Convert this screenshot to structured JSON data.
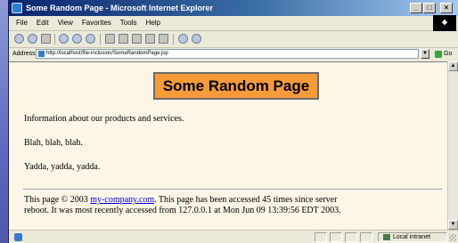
{
  "window": {
    "title": "Some Random Page - Microsoft Internet Explorer",
    "minimize": "_",
    "maximize": "□",
    "close": "×"
  },
  "menu": {
    "items": [
      "File",
      "Edit",
      "View",
      "Favorites",
      "Tools",
      "Help"
    ]
  },
  "address": {
    "label": "Address",
    "url": "http://localhost/file-inclusion/SomeRandomPage.jsp",
    "go_label": "Go"
  },
  "page": {
    "heading": "Some Random Page",
    "paragraphs": [
      "Information about our products and services.",
      "Blah, blah, blah.",
      "Yadda, yadda, yadda."
    ],
    "footer": {
      "prefix": "This page © 2003 ",
      "link_text": "my-company.com",
      "line1_rest": ". This page has been accessed 45 times since server",
      "line2": "reboot. It was most recently accessed from 127.0.0.1 at Mon Jun 09 13:39:56 EDT 2003."
    }
  },
  "status": {
    "zone": "Local intranet"
  },
  "colors": {
    "page_background": "#fdf5e6",
    "heading_background": "#f79a3a",
    "link": "#0000ee"
  }
}
